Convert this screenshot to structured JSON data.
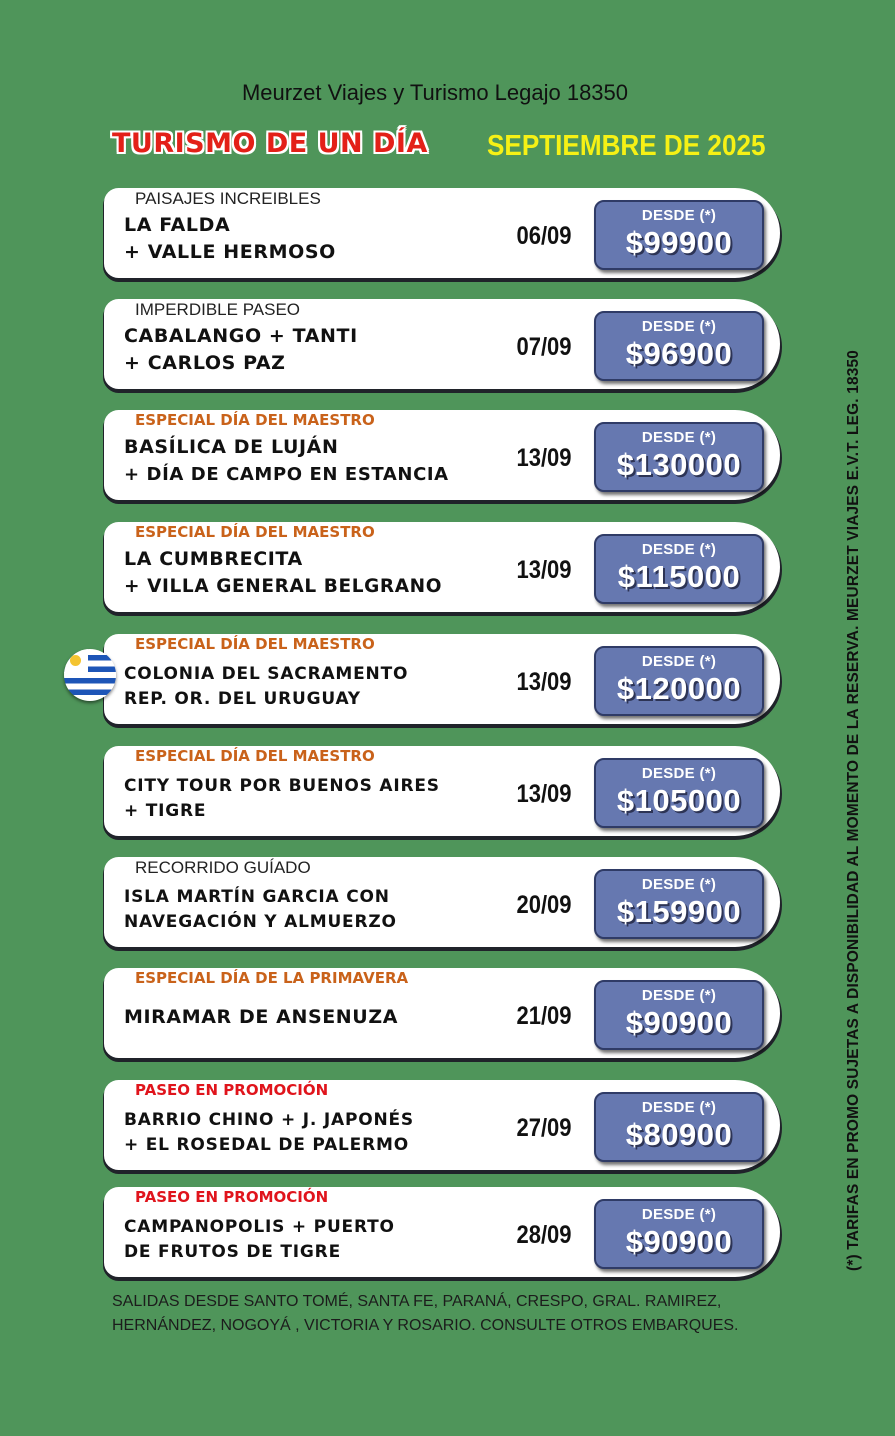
{
  "header": {
    "agency": "Meurzet Viajes y Turismo Legajo 18350",
    "title": "TURISMO DE UN DÍA",
    "month": "SEPTIEMBRE DE 2025"
  },
  "trips": [
    {
      "tag": "PAISAJES INCREIBLES",
      "lines": [
        "LA FALDA",
        "+ VALLE HERMOSO"
      ],
      "date": "06/09",
      "price_label": "DESDE (*)",
      "price": "$99900"
    },
    {
      "tag": "IMPERDIBLE PASEO",
      "lines": [
        "CABALANGO + TANTI",
        "+ CARLOS PAZ"
      ],
      "date": "07/09",
      "price_label": "DESDE (*)",
      "price": "$96900"
    },
    {
      "tag": "ESPECIAL DÍA DEL MAESTRO",
      "lines": [
        "BASÍLICA DE LUJÁN",
        "+ DÍA DE CAMPO EN ESTANCIA"
      ],
      "date": "13/09",
      "price_label": "DESDE (*)",
      "price": "$130000"
    },
    {
      "tag": "ESPECIAL DÍA DEL MAESTRO",
      "lines": [
        "LA CUMBRECITA",
        "+ VILLA GENERAL BELGRANO"
      ],
      "date": "13/09",
      "price_label": "DESDE (*)",
      "price": "$115000"
    },
    {
      "tag": "ESPECIAL DÍA DEL MAESTRO",
      "lines": [
        "COLONIA DEL SACRAMENTO",
        "REP. OR. DEL URUGUAY"
      ],
      "date": "13/09",
      "price_label": "DESDE (*)",
      "price": "$120000"
    },
    {
      "tag": "ESPECIAL DÍA DEL MAESTRO",
      "lines": [
        "CITY TOUR POR BUENOS AIRES",
        "+ TIGRE"
      ],
      "date": "13/09",
      "price_label": "DESDE (*)",
      "price": "$105000"
    },
    {
      "tag": "RECORRIDO GUÍADO",
      "lines": [
        "ISLA MARTÍN GARCIA CON",
        "NAVEGACIÓN Y ALMUERZO"
      ],
      "date": "20/09",
      "price_label": "DESDE (*)",
      "price": "$159900"
    },
    {
      "tag": "ESPECIAL DÍA DE LA PRIMAVERA",
      "lines": [
        "MIRAMAR DE ANSENUZA"
      ],
      "date": "21/09",
      "price_label": "DESDE (*)",
      "price": "$90900"
    },
    {
      "tag": "PASEO EN PROMOCIÓN",
      "lines": [
        "BARRIO CHINO + J. JAPONÉS",
        "+ EL ROSEDAL DE PALERMO"
      ],
      "date": "27/09",
      "price_label": "DESDE (*)",
      "price": "$80900"
    },
    {
      "tag": "PASEO EN PROMOCIÓN",
      "lines": [
        "CAMPANOPOLIS +  PUERTO",
        "DE FRUTOS DE TIGRE"
      ],
      "date": "28/09",
      "price_label": "DESDE (*)",
      "price": "$90900"
    }
  ],
  "flag_icon": "uruguay-flag-icon",
  "side_note": "(*) TARIFAS EN PROMO SUJETAS A DISPONIBILIDAD AL MOMENTO DE LA RESERVA. MEURZET VIAJES E.V.T. LEG. 18350",
  "footer": {
    "line1": "SALIDAS DESDE SANTO TOMÉ, SANTA FE, PARANÁ, CRESPO, GRAL. RAMIREZ,",
    "line2": "HERNÁNDEZ, NOGOYÁ , VICTORIA Y ROSARIO. CONSULTE OTROS EMBARQUES."
  },
  "colors": {
    "background": "#4f955a",
    "title_red": "#e32018",
    "month_yellow": "#f6f115",
    "tag_orange": "#c9621a",
    "tag_red": "#e0141c",
    "price_box": "#6678b0"
  }
}
